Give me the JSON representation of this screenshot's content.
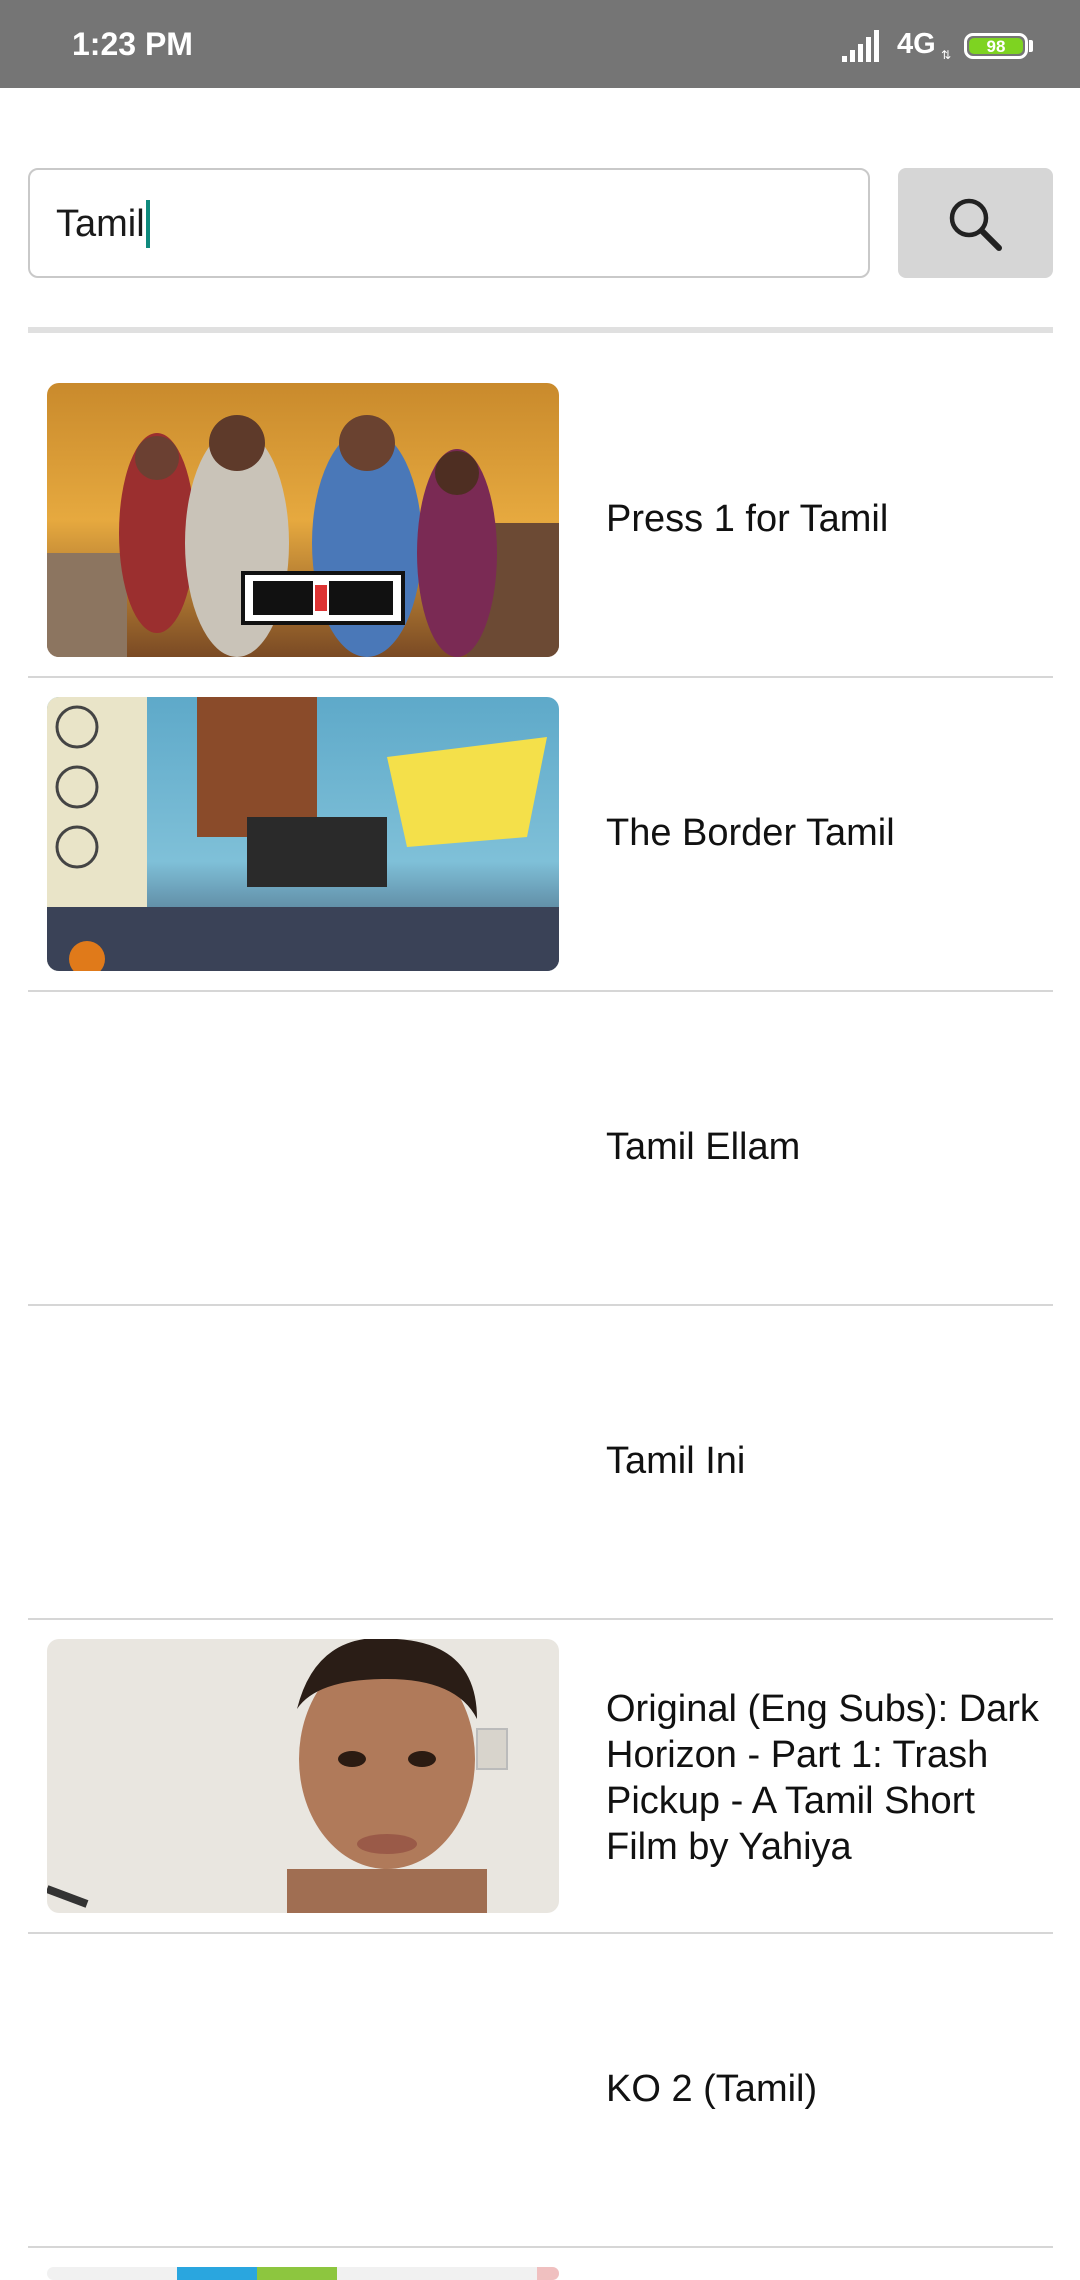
{
  "status_bar": {
    "time": "1:23 PM",
    "network": "4G",
    "battery": "98",
    "battery_level": 98
  },
  "search": {
    "query": "Tamil",
    "button_icon": "search-icon"
  },
  "results": [
    {
      "title": "Press 1 for Tamil",
      "has_thumbnail": true
    },
    {
      "title": "The Border Tamil",
      "has_thumbnail": true
    },
    {
      "title": "Tamil Ellam",
      "has_thumbnail": false
    },
    {
      "title": "Tamil Ini",
      "has_thumbnail": false
    },
    {
      "title": "Original (Eng Subs): Dark Horizon - Part 1: Trash Pickup - A Tamil Short Film by Yahiya",
      "has_thumbnail": true
    },
    {
      "title": "KO 2 (Tamil)",
      "has_thumbnail": false
    }
  ],
  "colors": {
    "status_bar": "#757575",
    "battery_fill": "#7ed321",
    "cursor": "#0f8a7d",
    "search_button": "#d6d6d6"
  }
}
